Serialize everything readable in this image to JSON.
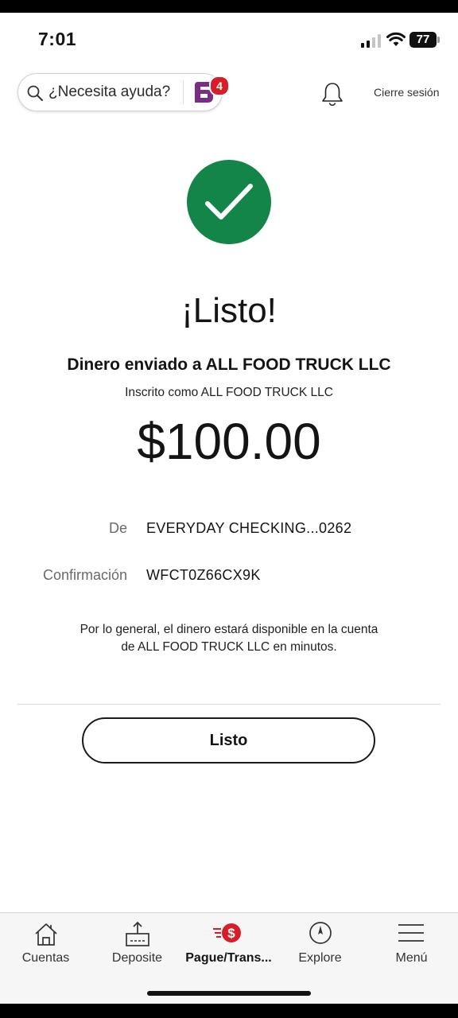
{
  "status_bar": {
    "time": "7:01",
    "battery": "77"
  },
  "header": {
    "search_placeholder": "¿Necesita ayuda?",
    "notification_count": "4",
    "logout_label": "Cierre sesión"
  },
  "confirmation": {
    "title": "¡Listo!",
    "sent_to": "Dinero enviado a ALL FOOD TRUCK LLC",
    "registered_as": "Inscrito como ALL FOOD TRUCK LLC",
    "amount": "$100.00",
    "details": [
      {
        "label": "De",
        "value": "EVERYDAY CHECKING...0262"
      },
      {
        "label": "Confirmación",
        "value": "WFCT0Z66CX9K"
      }
    ],
    "note_line1": "Por lo general, el dinero estará disponible en la cuenta",
    "note_line2": "de ALL FOOD TRUCK LLC en minutos.",
    "done_button": "Listo"
  },
  "bottom_nav": [
    {
      "label": "Cuentas",
      "icon": "home-icon"
    },
    {
      "label": "Deposite",
      "icon": "deposit-icon"
    },
    {
      "label": "Pague/Trans...",
      "icon": "pay-transfer-icon",
      "active": true
    },
    {
      "label": "Explore",
      "icon": "compass-icon"
    },
    {
      "label": "Menú",
      "icon": "hamburger-menu-icon"
    }
  ],
  "colors": {
    "success_green": "#148548",
    "brand_red": "#d71e28",
    "fargo_purple": "#7b2d83"
  }
}
